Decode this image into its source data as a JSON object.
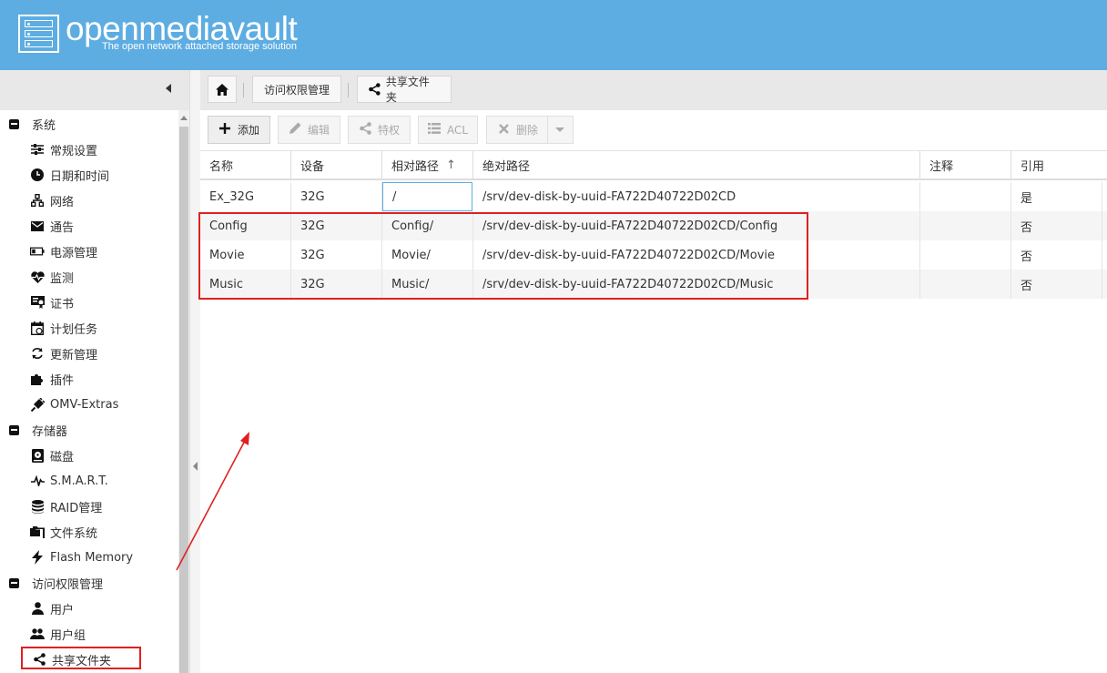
{
  "header": {
    "brand": "openmediavault",
    "tagline": "The open network attached storage solution"
  },
  "sidebar": {
    "groups": [
      {
        "label": "系统",
        "items": [
          "常规设置",
          "日期和时间",
          "网络",
          "通告",
          "电源管理",
          "监测",
          "证书",
          "计划任务",
          "更新管理",
          "插件",
          "OMV-Extras"
        ]
      },
      {
        "label": "存储器",
        "items": [
          "磁盘",
          "S.M.A.R.T.",
          "RAID管理",
          "文件系统",
          "Flash Memory"
        ]
      },
      {
        "label": "访问权限管理",
        "items": [
          "用户",
          "用户组",
          "共享文件夹"
        ]
      }
    ]
  },
  "breadcrumb": {
    "items": [
      "访问权限管理",
      "共享文件夹"
    ]
  },
  "toolbar": {
    "add": "添加",
    "edit": "编辑",
    "privileges": "特权",
    "acl": "ACL",
    "delete": "删除"
  },
  "grid": {
    "columns": [
      "名称",
      "设备",
      "相对路径",
      "绝对路径",
      "注释",
      "引用"
    ],
    "sort_indicator": "↑",
    "rows": [
      [
        "Ex_32G",
        "32G",
        "/",
        "/srv/dev-disk-by-uuid-FA722D40722D02CD",
        "",
        "是"
      ],
      [
        "Config",
        "32G",
        "Config/",
        "/srv/dev-disk-by-uuid-FA722D40722D02CD/Config",
        "",
        "否"
      ],
      [
        "Movie",
        "32G",
        "Movie/",
        "/srv/dev-disk-by-uuid-FA722D40722D02CD/Movie",
        "",
        "否"
      ],
      [
        "Music",
        "32G",
        "Music/",
        "/srv/dev-disk-by-uuid-FA722D40722D02CD/Music",
        "",
        "否"
      ]
    ]
  },
  "colors": {
    "header_bg": "#5dade2",
    "annotation": "#e02020"
  }
}
